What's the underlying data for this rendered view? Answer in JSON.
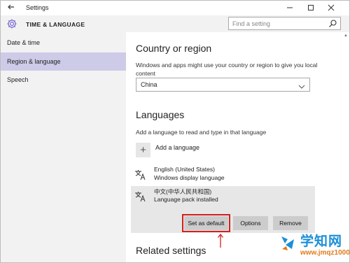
{
  "window": {
    "title": "Settings",
    "back_icon": "back-arrow-icon"
  },
  "header": {
    "section": "TIME & LANGUAGE",
    "icon": "gear-icon"
  },
  "search": {
    "placeholder": "Find a setting"
  },
  "sidebar": {
    "items": [
      {
        "label": "Date & time",
        "active": false
      },
      {
        "label": "Region & language",
        "active": true
      },
      {
        "label": "Speech",
        "active": false
      }
    ]
  },
  "region": {
    "heading": "Country or region",
    "description": "Windows and apps might use your country or region to give you local content",
    "selected": "China"
  },
  "languages": {
    "heading": "Languages",
    "description": "Add a language to read and type in that language",
    "add_label": "Add a language",
    "items": [
      {
        "name": "English (United States)",
        "status": "Windows display language"
      },
      {
        "name": "中文(中华人民共和国)",
        "status": "Language pack installed"
      }
    ],
    "buttons": {
      "set_default": "Set as default",
      "options": "Options",
      "remove": "Remove"
    }
  },
  "related": {
    "heading": "Related settings"
  },
  "watermark": {
    "text": "学知网",
    "url": "www.jmqz1000.com"
  },
  "colors": {
    "accent": "#6a5acd",
    "active_nav": "#cdcbe8",
    "highlight_border": "#d32020"
  }
}
